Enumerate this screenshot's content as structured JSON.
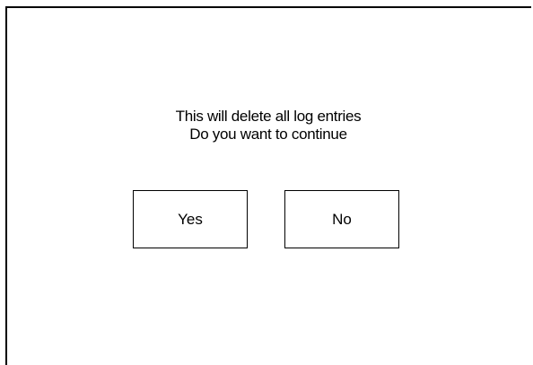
{
  "dialog": {
    "message_line_1": "This will delete all log entries",
    "message_line_2": "Do you want to continue",
    "yes_label": "Yes",
    "no_label": "No"
  },
  "colors": {
    "background": "#ffffff",
    "text": "#000000",
    "border": "#000000"
  }
}
